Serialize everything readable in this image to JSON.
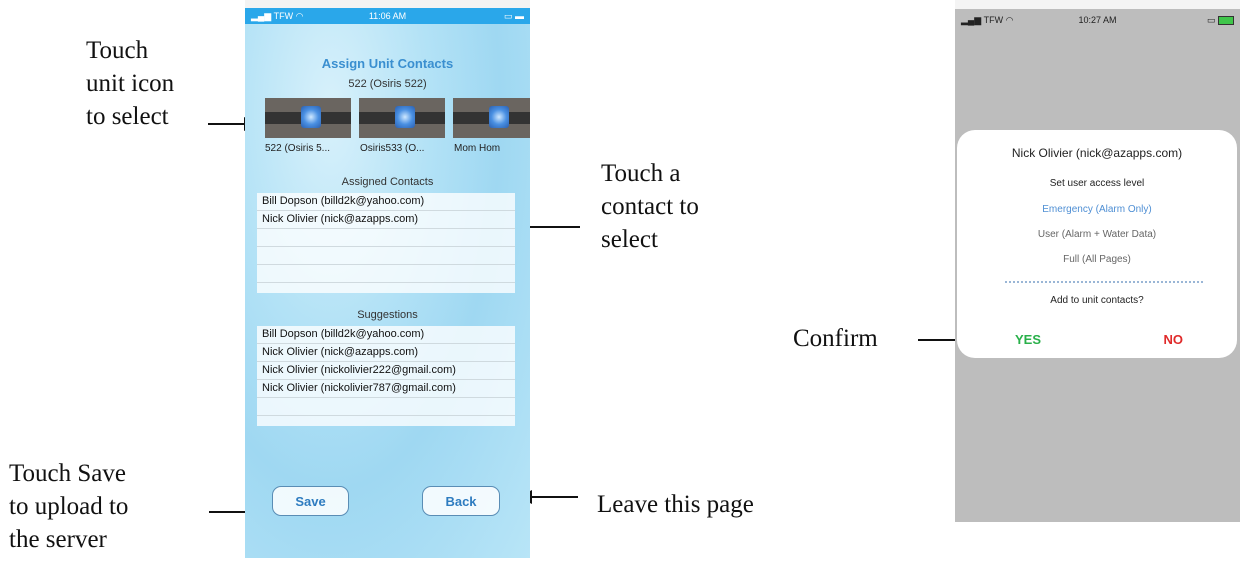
{
  "annotations": {
    "touch_unit_icon": [
      "Touch",
      "unit icon",
      "to select"
    ],
    "touch_contact": [
      "Touch a",
      "contact to",
      "select"
    ],
    "touch_save": [
      "Touch Save",
      "to upload to",
      "the server"
    ],
    "leave_page": "Leave this page",
    "confirm": "Confirm"
  },
  "phone1": {
    "status": {
      "carrier": "TFW",
      "time": "11:06 AM"
    },
    "title": "Assign Unit Contacts",
    "subtitle": "522 (Osiris 522)",
    "units": [
      "522 (Osiris 5...",
      "Osiris533 (O...",
      "Mom Hom"
    ],
    "assigned_title": "Assigned Contacts",
    "assigned": [
      "Bill Dopson (billd2k@yahoo.com)",
      "Nick Olivier (nick@azapps.com)"
    ],
    "suggestions_title": "Suggestions",
    "suggestions": [
      "Bill Dopson (billd2k@yahoo.com)",
      "Nick Olivier (nick@azapps.com)",
      "Nick Olivier (nickolivier222@gmail.com)",
      "Nick Olivier (nickolivier787@gmail.com)"
    ],
    "save_label": "Save",
    "back_label": "Back"
  },
  "phone2": {
    "status": {
      "carrier": "TFW",
      "time": "10:27 AM"
    },
    "dialog": {
      "title": "Nick Olivier (nick@azapps.com)",
      "prompt": "Set user access level",
      "options": [
        "Emergency (Alarm Only)",
        "User (Alarm + Water Data)",
        "Full (All Pages)"
      ],
      "question": "Add to unit contacts?",
      "yes": "YES",
      "no": "NO"
    }
  },
  "colors": {
    "accent": "#3a8fd0",
    "yes": "#29b04a",
    "no": "#e02a2a",
    "status_bar": "#2aa7ea"
  }
}
